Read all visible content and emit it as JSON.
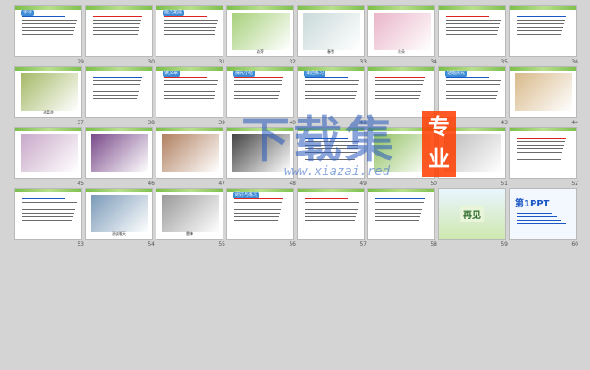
{
  "slides": [
    {
      "n": "29",
      "kind": "text",
      "title": "示标",
      "accent": "blue"
    },
    {
      "n": "30",
      "kind": "text",
      "accent": "red"
    },
    {
      "n": "31",
      "kind": "text",
      "title": "能力拓展",
      "accent": "red"
    },
    {
      "n": "32",
      "kind": "photo",
      "color": "#a6d07a",
      "cap": "幼芽"
    },
    {
      "n": "33",
      "kind": "photo",
      "color": "#c9d9d9",
      "cap": "春雪"
    },
    {
      "n": "34",
      "kind": "photo",
      "color": "#e9b4c8",
      "cap": "花朵"
    },
    {
      "n": "35",
      "kind": "text",
      "accent": "red"
    },
    {
      "n": "36",
      "kind": "text",
      "accent": "blue"
    },
    {
      "n": "37",
      "kind": "photo",
      "color": "#a4b866",
      "cap": "油菜花"
    },
    {
      "n": "38",
      "kind": "text",
      "accent": "blue"
    },
    {
      "n": "39",
      "kind": "text",
      "title": "读文章",
      "accent": "red"
    },
    {
      "n": "40",
      "kind": "text",
      "title": "探究小结",
      "accent": "red"
    },
    {
      "n": "41",
      "kind": "text",
      "title": "课后练习",
      "accent": "blue"
    },
    {
      "n": "42",
      "kind": "text",
      "accent": "red"
    },
    {
      "n": "43",
      "kind": "text",
      "title": "话题探究",
      "accent": "blue"
    },
    {
      "n": "44",
      "kind": "photo",
      "color": "#d8b98a",
      "cap": ""
    },
    {
      "n": "45",
      "kind": "photo",
      "color": "#c8a8c8",
      "cap": ""
    },
    {
      "n": "46",
      "kind": "photo",
      "color": "#7a4a8a",
      "cap": ""
    },
    {
      "n": "47",
      "kind": "photo",
      "color": "#b08060",
      "cap": ""
    },
    {
      "n": "48",
      "kind": "photo",
      "color": "#444444",
      "cap": ""
    },
    {
      "n": "49",
      "kind": "text",
      "accent": "blue"
    },
    {
      "n": "50",
      "kind": "photo",
      "color": "#90c060",
      "cap": ""
    },
    {
      "n": "51",
      "kind": "photo",
      "color": "#bbbbbb",
      "cap": ""
    },
    {
      "n": "52",
      "kind": "text",
      "accent": "red"
    },
    {
      "n": "53",
      "kind": "text",
      "accent": "blue"
    },
    {
      "n": "54",
      "kind": "photo",
      "color": "#7a9ab8",
      "cap": "漫谈聊天"
    },
    {
      "n": "55",
      "kind": "photo",
      "color": "#999999",
      "cap": "雷锋"
    },
    {
      "n": "56",
      "kind": "text",
      "title": "研讨与练习",
      "accent": "red"
    },
    {
      "n": "57",
      "kind": "text",
      "accent": "red"
    },
    {
      "n": "58",
      "kind": "text",
      "accent": "blue"
    },
    {
      "n": "59",
      "kind": "bye",
      "cap": "再见"
    },
    {
      "n": "60",
      "kind": "ppt",
      "cap": "第1PPT"
    }
  ],
  "watermark": {
    "main": "下载集",
    "side": "专业",
    "url": "www.xiazai.red"
  }
}
